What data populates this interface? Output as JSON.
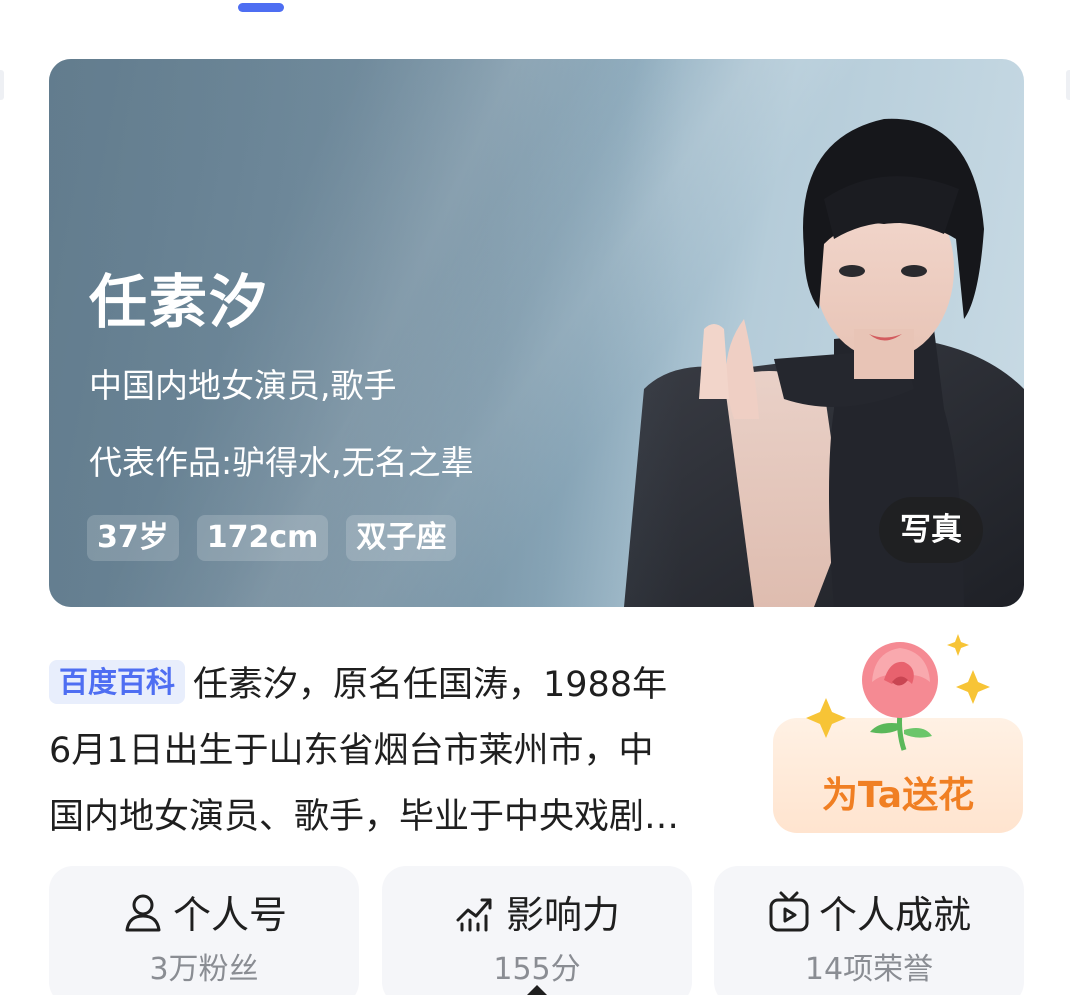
{
  "hero": {
    "name": "任素汐",
    "description": "中国内地女演员,歌手",
    "works": "代表作品:驴得水,无名之辈",
    "tags": [
      "37岁",
      "172cm",
      "双子座"
    ],
    "photo_button": "写真"
  },
  "intro": {
    "badge": "百度百科",
    "lines": [
      "任素汐，原名任国涛，1988年",
      "6月1日出生于山东省烟台市莱州市，中",
      "国内地女演员、歌手，毕业于中央戏剧…"
    ]
  },
  "flower": {
    "label": "为Ta送花"
  },
  "stats": [
    {
      "title": "个人号",
      "sub": "3万粉丝",
      "icon": "person-icon"
    },
    {
      "title": "影响力",
      "sub": "155分",
      "icon": "trend-chart-icon"
    },
    {
      "title": "个人成就",
      "sub": "14项荣誉",
      "icon": "tv-play-icon"
    }
  ],
  "colors": {
    "accent": "#4e6ef2",
    "flower_text": "#f07f23",
    "badge_bg": "#e8eefc"
  }
}
